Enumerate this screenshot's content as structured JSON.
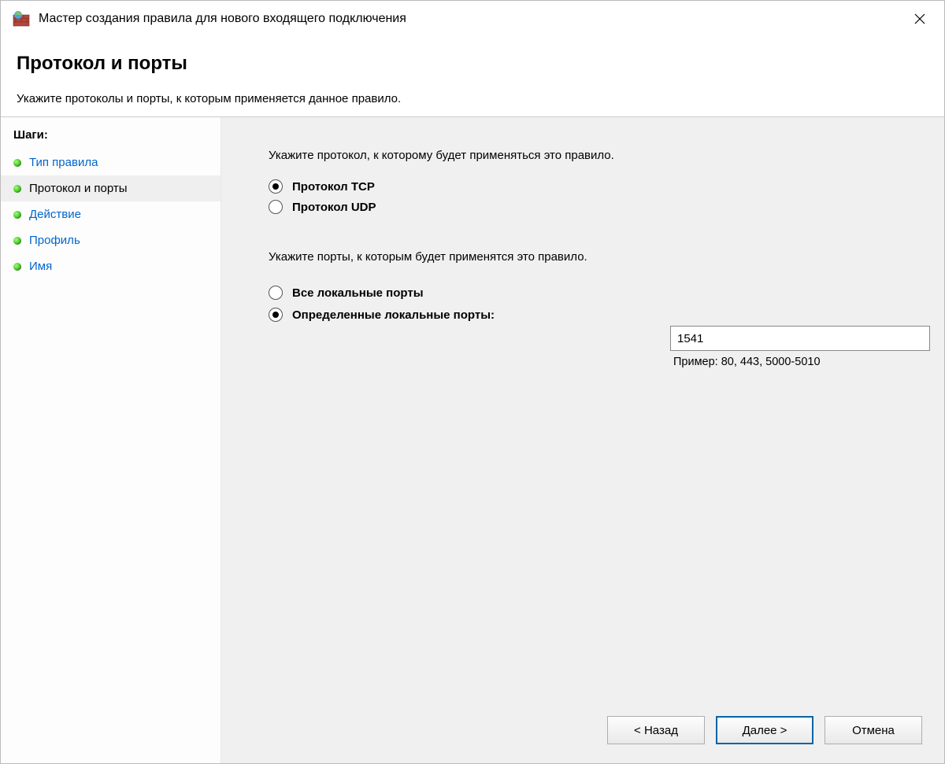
{
  "window": {
    "title": "Мастер создания правила для нового входящего подключения"
  },
  "header": {
    "heading": "Протокол и порты",
    "subtitle": "Укажите протоколы и порты, к которым применяется данное правило."
  },
  "sidebar": {
    "steps_label": "Шаги:",
    "steps": [
      {
        "label": "Тип правила"
      },
      {
        "label": "Протокол и порты"
      },
      {
        "label": "Действие"
      },
      {
        "label": "Профиль"
      },
      {
        "label": "Имя"
      }
    ],
    "current_index": 1
  },
  "content": {
    "protocol_prompt": "Укажите протокол, к которому будет применяться это правило.",
    "protocol_options": {
      "tcp": "Протокол TCP",
      "udp": "Протокол UDP",
      "selected": "tcp"
    },
    "ports_prompt": "Укажите порты, к которым будет применятся это правило.",
    "ports_options": {
      "all": "Все локальные порты",
      "specific": "Определенные локальные порты:",
      "selected": "specific"
    },
    "port_input_value": "1541",
    "port_example": "Пример: 80, 443, 5000-5010"
  },
  "buttons": {
    "back": "< Назад",
    "next": "Далее >",
    "cancel": "Отмена"
  }
}
